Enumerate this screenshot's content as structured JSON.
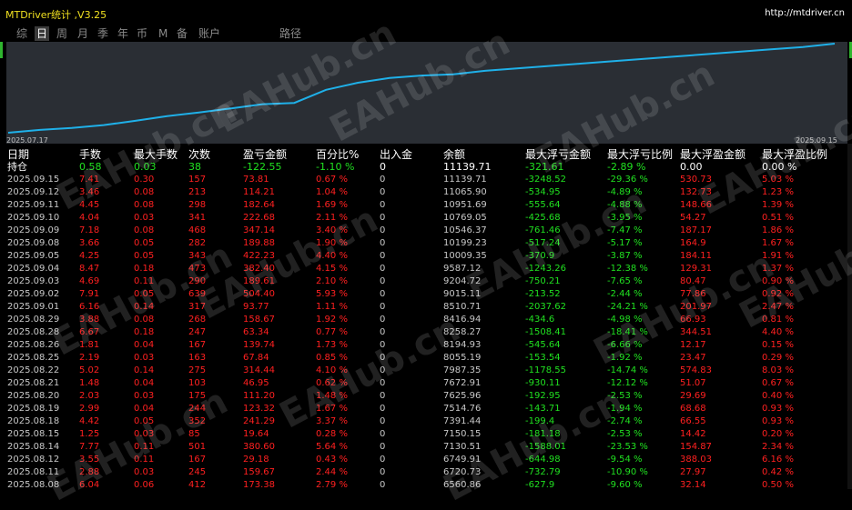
{
  "app": {
    "title": "MTDriver统计 ,V3.25",
    "url": "http://mtdriver.cn"
  },
  "tabs": [
    "综",
    "日",
    "周",
    "月",
    "季",
    "年",
    "币",
    "M",
    "备",
    "账户",
    "路径"
  ],
  "active_tab": 1,
  "chart_data": {
    "type": "line",
    "x_start_label": "2025.07.17",
    "x_end_label": "2025.09.15",
    "line_color": "#1fb0e8",
    "background": "#2a2e34",
    "values": [
      7400,
      7520,
      7600,
      7720,
      7900,
      8100,
      8250,
      8420,
      8600,
      8650,
      9200,
      9500,
      9700,
      9800,
      9850,
      10000,
      10100,
      10200,
      10300,
      10400,
      10500,
      10600,
      10700,
      10800,
      10900,
      11000,
      11140
    ]
  },
  "watermark": "EAHub.cn",
  "table": {
    "headers": [
      "日期",
      "手数",
      "最大手数",
      "次数",
      "盈亏金额",
      "百分比%",
      "出入金",
      "余额",
      "最大浮亏金额",
      "最大浮亏比例",
      "最大浮盈金额",
      "最大浮盈比例"
    ],
    "summary": [
      "持仓",
      "0.58",
      "0.03",
      "38",
      "-122.55",
      "-1.10 %",
      "0",
      "11139.71",
      "-321.61",
      "-2.89 %",
      "0.00",
      "0.00 %"
    ],
    "rows": [
      [
        "2025.09.15",
        "7.41",
        "0.30",
        "157",
        "73.81",
        "0.67 %",
        "0",
        "11139.71",
        "-3248.52",
        "-29.36 %",
        "530.73",
        "5.03 %"
      ],
      [
        "2025.09.12",
        "3.46",
        "0.08",
        "213",
        "114.21",
        "1.04 %",
        "0",
        "11065.90",
        "-534.95",
        "-4.89 %",
        "132.73",
        "1.23 %"
      ],
      [
        "2025.09.11",
        "4.45",
        "0.08",
        "298",
        "182.64",
        "1.69 %",
        "0",
        "10951.69",
        "-555.64",
        "-4.88 %",
        "148.66",
        "1.39 %"
      ],
      [
        "2025.09.10",
        "4.04",
        "0.03",
        "341",
        "222.68",
        "2.11 %",
        "0",
        "10769.05",
        "-425.68",
        "-3.95 %",
        "54.27",
        "0.51 %"
      ],
      [
        "2025.09.09",
        "7.18",
        "0.08",
        "468",
        "347.14",
        "3.40 %",
        "0",
        "10546.37",
        "-761.46",
        "-7.47 %",
        "187.17",
        "1.86 %"
      ],
      [
        "2025.09.08",
        "3.66",
        "0.05",
        "282",
        "189.88",
        "1.90 %",
        "0",
        "10199.23",
        "-517.24",
        "-5.17 %",
        "164.9",
        "1.67 %"
      ],
      [
        "2025.09.05",
        "4.25",
        "0.05",
        "343",
        "422.23",
        "4.40 %",
        "0",
        "10009.35",
        "-370.9",
        "-3.87 %",
        "184.11",
        "1.91 %"
      ],
      [
        "2025.09.04",
        "8.47",
        "0.18",
        "473",
        "382.40",
        "4.15 %",
        "0",
        "9587.12",
        "-1243.26",
        "-12.38 %",
        "129.31",
        "1.37 %"
      ],
      [
        "2025.09.03",
        "4.69",
        "0.11",
        "290",
        "189.61",
        "2.10 %",
        "0",
        "9204.72",
        "-750.21",
        "-7.65 %",
        "80.47",
        "0.90 %"
      ],
      [
        "2025.09.02",
        "7.91",
        "0.05",
        "639",
        "504.40",
        "5.93 %",
        "0",
        "9015.11",
        "-213.52",
        "-2.44 %",
        "77.86",
        "0.92 %"
      ],
      [
        "2025.09.01",
        "6.16",
        "0.14",
        "317",
        "93.77",
        "1.11 %",
        "0",
        "8510.71",
        "-2037.62",
        "-24.21 %",
        "201.97",
        "2.47 %"
      ],
      [
        "2025.08.29",
        "3.88",
        "0.08",
        "268",
        "158.67",
        "1.92 %",
        "0",
        "8416.94",
        "-434.6",
        "-4.98 %",
        "66.93",
        "0.81 %"
      ],
      [
        "2025.08.28",
        "6.67",
        "0.18",
        "247",
        "63.34",
        "0.77 %",
        "0",
        "8258.27",
        "-1508.41",
        "-18.41 %",
        "344.51",
        "4.40 %"
      ],
      [
        "2025.08.26",
        "1.81",
        "0.04",
        "167",
        "139.74",
        "1.73 %",
        "0",
        "8194.93",
        "-545.64",
        "-6.66 %",
        "12.17",
        "0.15 %"
      ],
      [
        "2025.08.25",
        "2.19",
        "0.03",
        "163",
        "67.84",
        "0.85 %",
        "0",
        "8055.19",
        "-153.54",
        "-1.92 %",
        "23.47",
        "0.29 %"
      ],
      [
        "2025.08.22",
        "5.02",
        "0.14",
        "275",
        "314.44",
        "4.10 %",
        "0",
        "7987.35",
        "-1178.55",
        "-14.74 %",
        "574.83",
        "8.03 %"
      ],
      [
        "2025.08.21",
        "1.48",
        "0.04",
        "103",
        "46.95",
        "0.62 %",
        "0",
        "7672.91",
        "-930.11",
        "-12.12 %",
        "51.07",
        "0.67 %"
      ],
      [
        "2025.08.20",
        "2.03",
        "0.03",
        "175",
        "111.20",
        "1.48 %",
        "0",
        "7625.96",
        "-192.95",
        "-2.53 %",
        "29.69",
        "0.40 %"
      ],
      [
        "2025.08.19",
        "2.99",
        "0.04",
        "244",
        "123.32",
        "1.67 %",
        "0",
        "7514.76",
        "-143.71",
        "-1.94 %",
        "68.68",
        "0.93 %"
      ],
      [
        "2025.08.18",
        "4.42",
        "0.05",
        "352",
        "241.29",
        "3.37 %",
        "0",
        "7391.44",
        "-199.4",
        "-2.74 %",
        "66.55",
        "0.93 %"
      ],
      [
        "2025.08.15",
        "1.25",
        "0.03",
        "85",
        "19.64",
        "0.28 %",
        "0",
        "7150.15",
        "-181.18",
        "-2.53 %",
        "14.42",
        "0.20 %"
      ],
      [
        "2025.08.14",
        "7.77",
        "0.11",
        "501",
        "380.60",
        "5.64 %",
        "0",
        "7130.51",
        "-1588.01",
        "-23.53 %",
        "154.87",
        "2.34 %"
      ],
      [
        "2025.08.12",
        "3.55",
        "0.11",
        "167",
        "29.18",
        "0.43 %",
        "0",
        "6749.91",
        "-644.98",
        "-9.54 %",
        "388.03",
        "6.16 %"
      ],
      [
        "2025.08.11",
        "2.88",
        "0.03",
        "245",
        "159.67",
        "2.44 %",
        "0",
        "6720.73",
        "-732.79",
        "-10.90 %",
        "27.97",
        "0.42 %"
      ],
      [
        "2025.08.08",
        "6.04",
        "0.06",
        "412",
        "173.38",
        "2.79 %",
        "0",
        "6560.86",
        "-627.9",
        "-9.60 %",
        "32.14",
        "0.50 %"
      ]
    ]
  }
}
